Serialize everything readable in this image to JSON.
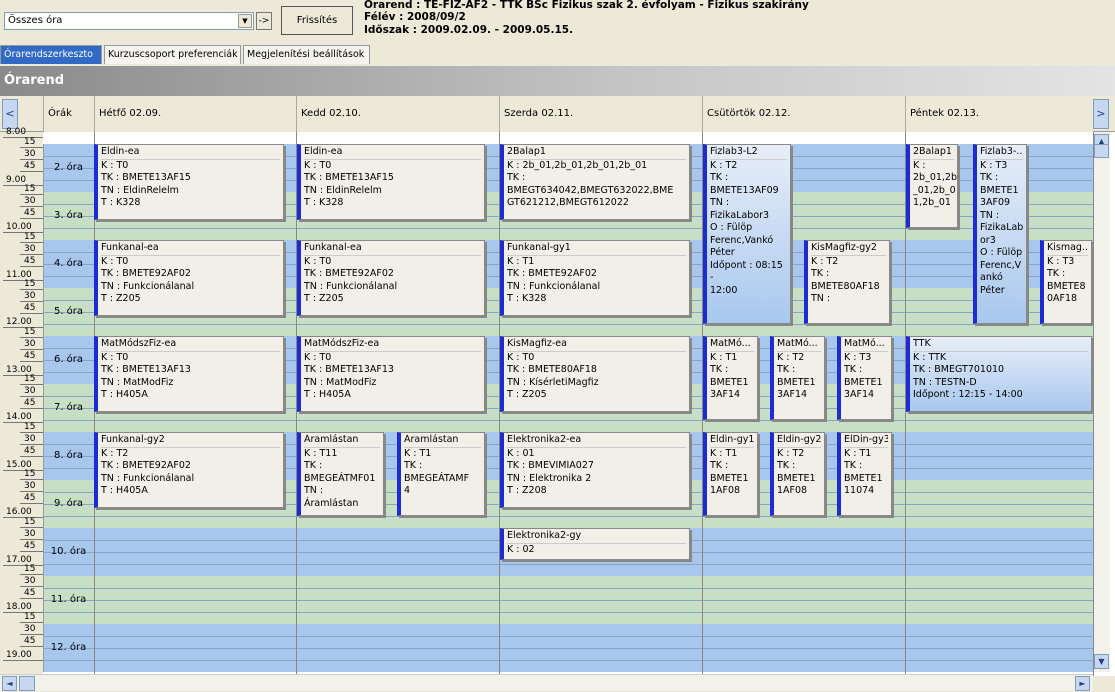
{
  "toolbar": {
    "combo_value": "Összes óra",
    "go_label": "->",
    "refresh_label": "Frissítés"
  },
  "header": {
    "line1": "Órarend : TE-FIZ-AF2 - TTK BSc Fizikus szak 2. évfolyam - Fizikus szakirány",
    "line2": "Félév : 2008/09/2",
    "line3": "Időszak : 2009.02.09. - 2009.05.15."
  },
  "tabs": [
    "Órarendszerkeszto",
    "Kurzuscsoport preferenciák",
    "Megjelenítési beállítások"
  ],
  "title": "Órarend",
  "nav": {
    "prev": "<",
    "next": ">"
  },
  "columns": {
    "orak": "Órák",
    "days": [
      "Hétfő  02.09.",
      "Kedd  02.10.",
      "Szerda  02.11.",
      "Csütörtök  02.12.",
      "Péntek  02.13."
    ]
  },
  "hours": [
    "8.00",
    "9.00",
    "10.00",
    "11.00",
    "12.00",
    "13.00",
    "14.00",
    "15.00",
    "16.00",
    "17.00",
    "18.00",
    "19.00"
  ],
  "quarters": [
    "15",
    "30",
    "45"
  ],
  "periods": [
    "2. óra",
    "3. óra",
    "4. óra",
    "5. óra",
    "6. óra",
    "7. óra",
    "8. óra",
    "9. óra",
    "10. óra",
    "11. óra",
    "12. óra"
  ],
  "events": [
    {
      "lines": [
        "Eldin-ea",
        "K : T0",
        "TK : BMETE13AF15",
        "TN : EldinRelelm",
        "T : K328"
      ]
    },
    {
      "lines": [
        "Eldin-ea",
        "K : T0",
        "TK : BMETE13AF15",
        "TN : EldinRelelm",
        "T : K328"
      ]
    },
    {
      "lines": [
        "2Balap1",
        "K : 2b_01,2b_01,2b_01,2b_01",
        "TK :",
        "BMEGT634042,BMEGT632022,BME",
        "GT621212,BMEGT612022"
      ]
    },
    {
      "lines": [
        "Fizlab3-L2",
        "K : T2",
        "TK :",
        "BMETE13AF09",
        "TN :",
        "FizikaLabor3",
        "O : Fülöp",
        "Ferenc,Vankó",
        "Péter",
        "Időpont : 08:15 -",
        "12:00"
      ]
    },
    {
      "lines": [
        "2Balap1",
        "K :",
        "2b_01,2b",
        "_01,2b_0",
        "1,2b_01"
      ]
    },
    {
      "lines": [
        "Fizlab3-...",
        "K : T3",
        "TK :",
        "BMETE1",
        "3AF09",
        "TN :",
        "FizikaLab",
        "or3",
        "O : Fülöp",
        "Ferenc,V",
        "ankó",
        "Péter"
      ]
    },
    {
      "lines": [
        "Funkanal-ea",
        "K : T0",
        "TK : BMETE92AF02",
        "TN : Funkcionálanal",
        "T : Z205"
      ]
    },
    {
      "lines": [
        "Funkanal-ea",
        "K : T0",
        "TK : BMETE92AF02",
        "TN : Funkcionálanal",
        "T : Z205"
      ]
    },
    {
      "lines": [
        "Funkanal-gy1",
        "K : T1",
        "TK : BMETE92AF02",
        "TN : Funkcionálanal",
        "T : K328"
      ]
    },
    {
      "lines": [
        "KisMagfiz-gy2",
        "K : T2",
        "TK :",
        "BMETE80AF18",
        "TN :"
      ]
    },
    {
      "lines": [
        "Kismag...",
        "K : T3",
        "TK :",
        "BMETE8",
        "0AF18"
      ]
    },
    {
      "lines": [
        "MatMódszFiz-ea",
        "K : T0",
        "TK : BMETE13AF13",
        "TN : MatModFiz",
        "T : H405A"
      ]
    },
    {
      "lines": [
        "MatMódszFiz-ea",
        "K : T0",
        "TK : BMETE13AF13",
        "TN : MatModFiz",
        "T : H405A"
      ]
    },
    {
      "lines": [
        "KisMagfiz-ea",
        "K : T0",
        "TK : BMETE80AF18",
        "TN : KísérletiMagfiz",
        "T : Z205"
      ]
    },
    {
      "lines": [
        "MatMó...",
        "K : T1",
        "TK :",
        "BMETE1",
        "3AF14"
      ]
    },
    {
      "lines": [
        "MatMó...",
        "K : T2",
        "TK :",
        "BMETE1",
        "3AF14"
      ]
    },
    {
      "lines": [
        "MatMó...",
        "K : T3",
        "TK :",
        "BMETE1",
        "3AF14"
      ]
    },
    {
      "lines": [
        "TTK",
        "K : TTK",
        "TK : BMEGT701010",
        "TN : TESTN-D",
        "Időpont : 12:15 - 14:00"
      ]
    },
    {
      "lines": [
        "Funkanal-gy2",
        "K : T2",
        "TK : BMETE92AF02",
        "TN : Funkcionálanal",
        "T : H405A"
      ]
    },
    {
      "lines": [
        "Áramlástan",
        "K : T11",
        "TK :",
        "BMEGEÁTMF01",
        "TN : Áramlástan"
      ]
    },
    {
      "lines": [
        "Áramlástan",
        "K : T1",
        "TK :",
        "BMEGEÁTAMF",
        "4"
      ]
    },
    {
      "lines": [
        "Elektronika2-ea",
        "K : 01",
        "TK : BMEVIMIA027",
        "TN : Elektronika 2",
        "T : Z208"
      ]
    },
    {
      "lines": [
        "Eldin-gy1",
        "K : T1",
        "TK :",
        "BMETE1",
        "1AF08"
      ]
    },
    {
      "lines": [
        "Eldin-gy2",
        "K : T2",
        "TK :",
        "BMETE1",
        "1AF08"
      ]
    },
    {
      "lines": [
        "ElDin-gy3",
        "K : T1",
        "TK :",
        "BMETE1",
        "11074"
      ]
    },
    {
      "lines": [
        "Elektronika2-gy",
        "K : 02"
      ]
    }
  ]
}
